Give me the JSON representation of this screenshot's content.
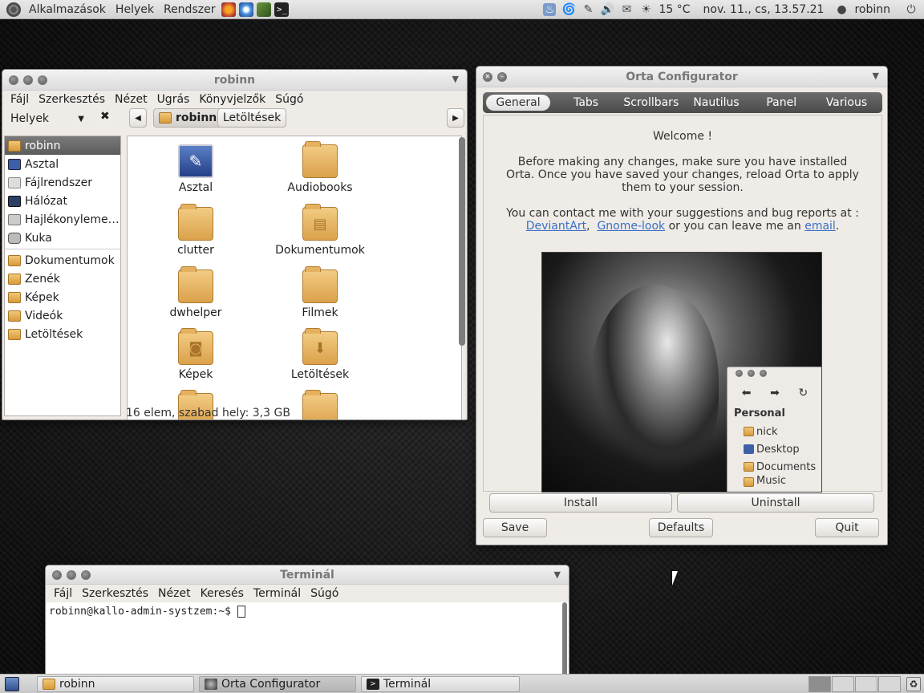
{
  "top_panel": {
    "menus": [
      "Alkalmazások",
      "Helyek",
      "Rendszer"
    ],
    "weather": "15 °C",
    "clock": "nov. 11., cs, 13.57.21",
    "user": "robinn",
    "launcher_icons": [
      "firefox-icon",
      "chromium-icon",
      "image-viewer-icon",
      "terminal-icon"
    ]
  },
  "nautilus": {
    "title": "robinn",
    "menu": [
      "Fájl",
      "Szerkesztés",
      "Nézet",
      "Ugrás",
      "Könyvjelzők",
      "Súgó"
    ],
    "places_label": "Helyek",
    "breadcrumbs": [
      "robinn",
      "Letöltések"
    ],
    "sidebar": [
      "robinn",
      "Asztal",
      "Fájlrendszer",
      "Hálózat",
      "Hajlékonyleme…",
      "Kuka",
      "Dokumentumok",
      "Zenék",
      "Képek",
      "Videók",
      "Letöltések"
    ],
    "files": [
      "Asztal",
      "Audiobooks",
      "clutter",
      "Dokumentumok",
      "dwhelper",
      "Filmek",
      "Képek",
      "Letöltések"
    ],
    "status": "16 elem, szabad hely: 3,3 GB"
  },
  "orta": {
    "title": "Orta Configurator",
    "tabs": [
      "General",
      "Tabs",
      "Scrollbars",
      "Nautilus",
      "Panel",
      "Various"
    ],
    "welcome": "Welcome !",
    "intro_line1": "Before making any changes, make sure you have installed",
    "intro_line2": "Orta. Once you have saved your changes, reload Orta to apply",
    "intro_line3": "them to your session.",
    "contact": "You can contact me with your suggestions and bug reports at :",
    "link_deviantart": "DeviantArt",
    "link_gnome_look": "Gnome-look",
    "or_text": "or you can leave me an",
    "link_email": "email",
    "preview": {
      "section": "Personal",
      "items": [
        "nick",
        "Desktop",
        "Documents",
        "Music"
      ]
    },
    "buttons": {
      "install": "Install",
      "uninstall": "Uninstall",
      "save": "Save",
      "defaults": "Defaults",
      "quit": "Quit"
    }
  },
  "terminal": {
    "title": "Terminál",
    "menu": [
      "Fájl",
      "Szerkesztés",
      "Nézet",
      "Keresés",
      "Terminál",
      "Súgó"
    ],
    "prompt": "robinn@kallo-admin-systzem:~$"
  },
  "taskbar": {
    "items": [
      "robinn",
      "Orta Configurator",
      "Terminál"
    ]
  }
}
